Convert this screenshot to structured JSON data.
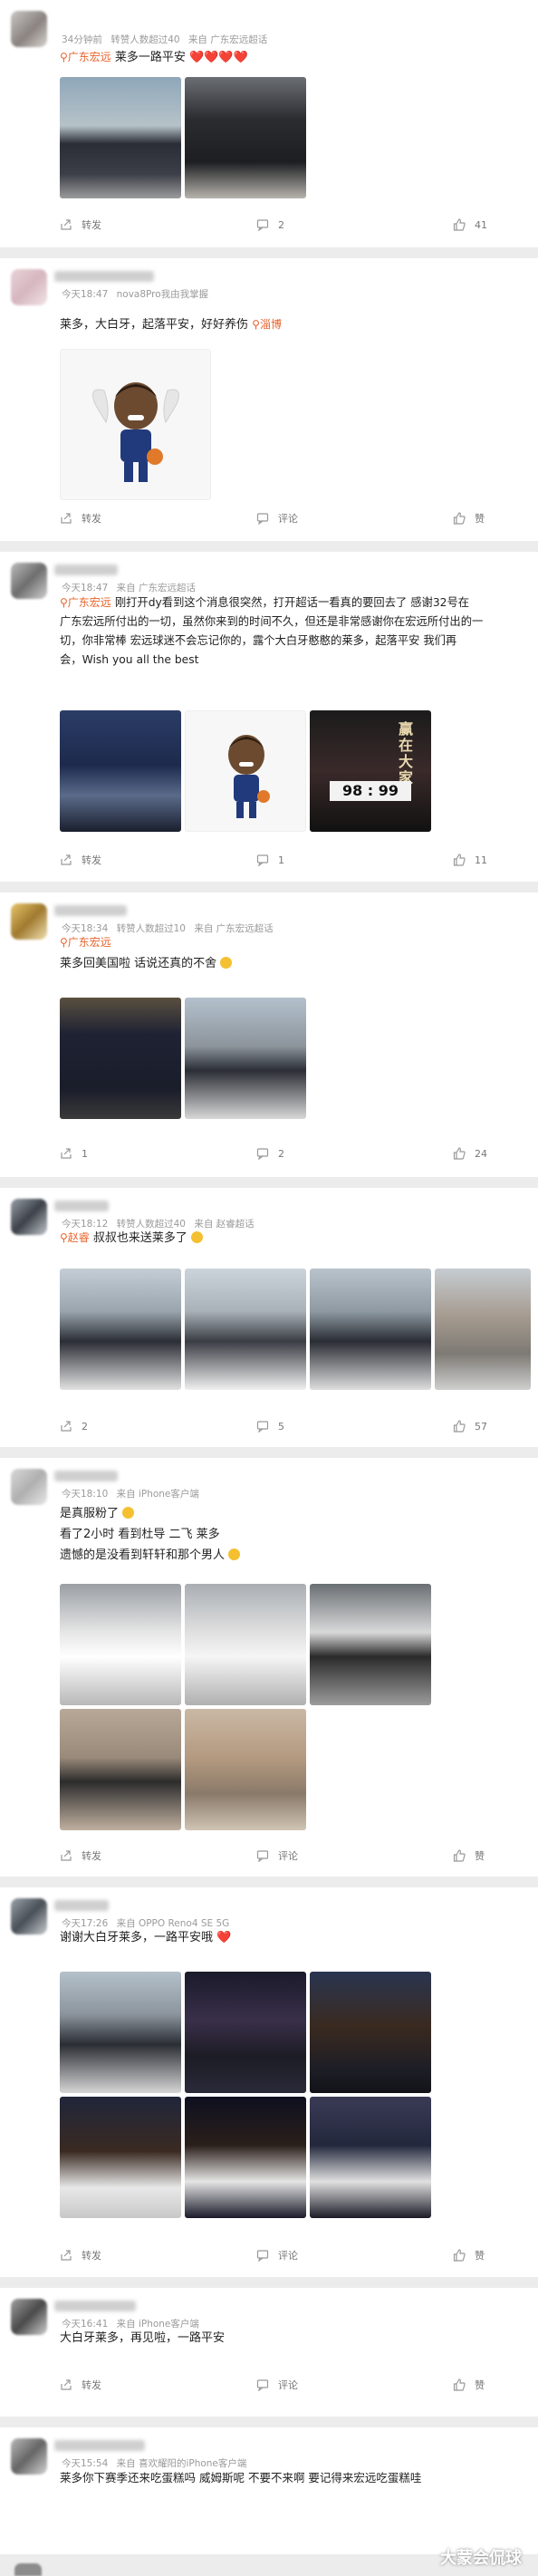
{
  "posts": [
    {
      "meta": {
        "time": "34分钟前",
        "extra": "转赞人数超过40",
        "source": "来自 广东宏远超话"
      },
      "tag": "广东宏远",
      "lines": [
        "莱多一路平安 ❤️❤️❤️❤️"
      ],
      "actions": {
        "share": "转发",
        "comment": "2",
        "like": "41"
      }
    },
    {
      "meta": {
        "time": "今天18:47",
        "extra": "nova8Pro我由我掌握",
        "source": ""
      },
      "lines": [
        "莱多，大白牙，起落平安，好好养伤"
      ],
      "location": "淄博",
      "actions": {
        "share": "转发",
        "comment": "评论",
        "like": "赞"
      }
    },
    {
      "meta": {
        "time": "今天18:47",
        "extra": "来自 广东宏远超话",
        "source": ""
      },
      "tag": "广东宏远",
      "lines": [
        "刚打开dy看到这个消息很突然，打开超话一看真的要回去了 感谢32号在",
        "广东宏远所付出的一切，虽然你来到的时间不久，但还是非常感谢你在宏远所付出的一",
        "切，你非常棒 宏远球迷不会忘记你的，露个大白牙憨憨的莱多，起落平安 我们再",
        "会，Wish you all the best"
      ],
      "image_text": {
        "scoreboard": "98 : 99",
        "poster_title": "赢\n在\n大\n家"
      },
      "actions": {
        "share": "转发",
        "comment": "1",
        "like": "11"
      }
    },
    {
      "meta": {
        "time": "今天18:34",
        "extra": "转赞人数超过10",
        "source": "来自 广东宏远超话"
      },
      "tag": "广东宏远",
      "lines": [
        "莱多回美国啦 话说还真的不舍"
      ],
      "actions": {
        "share": "1",
        "comment": "2",
        "like": "24"
      }
    },
    {
      "meta": {
        "time": "今天18:12",
        "extra": "转赞人数超过40",
        "source": "来自 赵睿超话"
      },
      "tag": "赵睿",
      "lines": [
        "叔叔也来送莱多了"
      ],
      "actions": {
        "share": "2",
        "comment": "5",
        "like": "57"
      }
    },
    {
      "meta": {
        "time": "今天18:10",
        "extra": "来自 iPhone客户端",
        "source": ""
      },
      "lines": [
        "是真服粉了",
        "看了2小时 看到杜导 二飞 莱多",
        "遗憾的是没看到轩轩和那个男人"
      ],
      "actions": {
        "share": "转发",
        "comment": "评论",
        "like": "赞"
      }
    },
    {
      "meta": {
        "time": "今天17:26",
        "extra": "来自 OPPO Reno4 SE 5G",
        "source": ""
      },
      "lines": [
        "谢谢大白牙莱多，一路平安哦 ❤️"
      ],
      "actions": {
        "share": "转发",
        "comment": "评论",
        "like": "赞"
      }
    },
    {
      "meta": {
        "time": "今天16:41",
        "extra": "来自 iPhone客户端",
        "source": ""
      },
      "lines": [
        "大白牙莱多，再见啦，一路平安"
      ],
      "actions": {
        "share": "转发",
        "comment": "评论",
        "like": "赞"
      }
    },
    {
      "meta": {
        "time": "今天15:54",
        "extra": "来自 喜欢耀阳的iPhone客户端",
        "source": ""
      },
      "lines": [
        "莱多你下赛季还来吃蛋糕吗  威姆斯呢 不要不来啊 要记得来宏远吃蛋糕哇"
      ],
      "actions": {
        "share": "",
        "comment": "",
        "like": ""
      }
    }
  ],
  "watermark": "大蒙会侃球",
  "colors": {
    "accent": "#e8632c",
    "heart": "#e3262c",
    "meta": "#9a9a9a",
    "separator": "#ececec"
  },
  "icons": [
    "share-icon",
    "comment-icon",
    "like-icon",
    "location-pin-icon",
    "tag-icon"
  ]
}
